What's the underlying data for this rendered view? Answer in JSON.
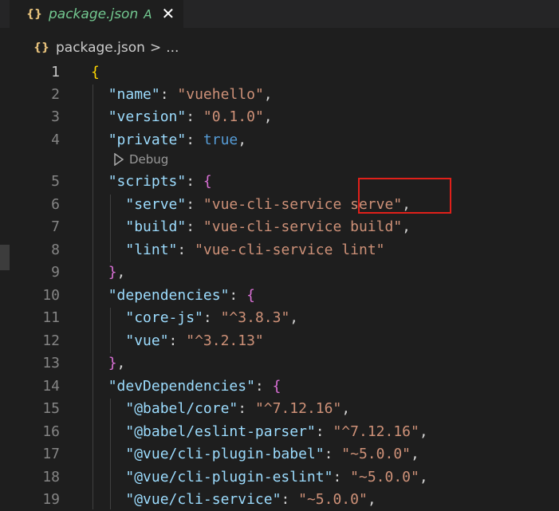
{
  "tab": {
    "icon_glyph": "{}",
    "name": "package.json",
    "status": "A",
    "close_glyph": "✕"
  },
  "breadcrumb": {
    "icon_glyph": "{}",
    "file": "package.json",
    "separator": ">",
    "more": "..."
  },
  "codelens": {
    "label": "Debug"
  },
  "lines": [
    {
      "n": "1",
      "tokens": [
        [
          "b1",
          "{"
        ]
      ]
    },
    {
      "n": "2",
      "tokens": [
        [
          "p",
          "  "
        ],
        [
          "k",
          "\"name\""
        ],
        [
          "p",
          ": "
        ],
        [
          "s",
          "\"vuehello\""
        ],
        [
          "p",
          ","
        ]
      ]
    },
    {
      "n": "3",
      "tokens": [
        [
          "p",
          "  "
        ],
        [
          "k",
          "\"version\""
        ],
        [
          "p",
          ": "
        ],
        [
          "s",
          "\"0.1.0\""
        ],
        [
          "p",
          ","
        ]
      ]
    },
    {
      "n": "4",
      "tokens": [
        [
          "p",
          "  "
        ],
        [
          "k",
          "\"private\""
        ],
        [
          "p",
          ": "
        ],
        [
          "kw",
          "true"
        ],
        [
          "p",
          ","
        ]
      ]
    },
    {
      "n": "5",
      "tokens": [
        [
          "p",
          "  "
        ],
        [
          "k",
          "\"scripts\""
        ],
        [
          "p",
          ": "
        ],
        [
          "b2",
          "{"
        ]
      ]
    },
    {
      "n": "6",
      "tokens": [
        [
          "p",
          "    "
        ],
        [
          "k",
          "\"serve\""
        ],
        [
          "p",
          ": "
        ],
        [
          "s",
          "\"vue-cli-service serve\""
        ],
        [
          "p",
          ","
        ]
      ]
    },
    {
      "n": "7",
      "tokens": [
        [
          "p",
          "    "
        ],
        [
          "k",
          "\"build\""
        ],
        [
          "p",
          ": "
        ],
        [
          "s",
          "\"vue-cli-service build\""
        ],
        [
          "p",
          ","
        ]
      ]
    },
    {
      "n": "8",
      "tokens": [
        [
          "p",
          "    "
        ],
        [
          "k",
          "\"lint\""
        ],
        [
          "p",
          ": "
        ],
        [
          "s",
          "\"vue-cli-service lint\""
        ]
      ]
    },
    {
      "n": "9",
      "tokens": [
        [
          "p",
          "  "
        ],
        [
          "b2",
          "}"
        ],
        [
          "p",
          ","
        ]
      ]
    },
    {
      "n": "10",
      "tokens": [
        [
          "p",
          "  "
        ],
        [
          "k",
          "\"dependencies\""
        ],
        [
          "p",
          ": "
        ],
        [
          "b2",
          "{"
        ]
      ]
    },
    {
      "n": "11",
      "tokens": [
        [
          "p",
          "    "
        ],
        [
          "k",
          "\"core-js\""
        ],
        [
          "p",
          ": "
        ],
        [
          "s",
          "\"^3.8.3\""
        ],
        [
          "p",
          ","
        ]
      ]
    },
    {
      "n": "12",
      "tokens": [
        [
          "p",
          "    "
        ],
        [
          "k",
          "\"vue\""
        ],
        [
          "p",
          ": "
        ],
        [
          "s",
          "\"^3.2.13\""
        ]
      ]
    },
    {
      "n": "13",
      "tokens": [
        [
          "p",
          "  "
        ],
        [
          "b2",
          "}"
        ],
        [
          "p",
          ","
        ]
      ]
    },
    {
      "n": "14",
      "tokens": [
        [
          "p",
          "  "
        ],
        [
          "k",
          "\"devDependencies\""
        ],
        [
          "p",
          ": "
        ],
        [
          "b2",
          "{"
        ]
      ]
    },
    {
      "n": "15",
      "tokens": [
        [
          "p",
          "    "
        ],
        [
          "k",
          "\"@babel/core\""
        ],
        [
          "p",
          ": "
        ],
        [
          "s",
          "\"^7.12.16\""
        ],
        [
          "p",
          ","
        ]
      ]
    },
    {
      "n": "16",
      "tokens": [
        [
          "p",
          "    "
        ],
        [
          "k",
          "\"@babel/eslint-parser\""
        ],
        [
          "p",
          ": "
        ],
        [
          "s",
          "\"^7.12.16\""
        ],
        [
          "p",
          ","
        ]
      ]
    },
    {
      "n": "17",
      "tokens": [
        [
          "p",
          "    "
        ],
        [
          "k",
          "\"@vue/cli-plugin-babel\""
        ],
        [
          "p",
          ": "
        ],
        [
          "s",
          "\"~5.0.0\""
        ],
        [
          "p",
          ","
        ]
      ]
    },
    {
      "n": "18",
      "tokens": [
        [
          "p",
          "    "
        ],
        [
          "k",
          "\"@vue/cli-plugin-eslint\""
        ],
        [
          "p",
          ": "
        ],
        [
          "s",
          "\"~5.0.0\""
        ],
        [
          "p",
          ","
        ]
      ]
    },
    {
      "n": "19",
      "tokens": [
        [
          "p",
          "    "
        ],
        [
          "k",
          "\"@vue/cli-service\""
        ],
        [
          "p",
          ": "
        ],
        [
          "s",
          "\"~5.0.0\""
        ],
        [
          "p",
          ","
        ]
      ]
    }
  ]
}
